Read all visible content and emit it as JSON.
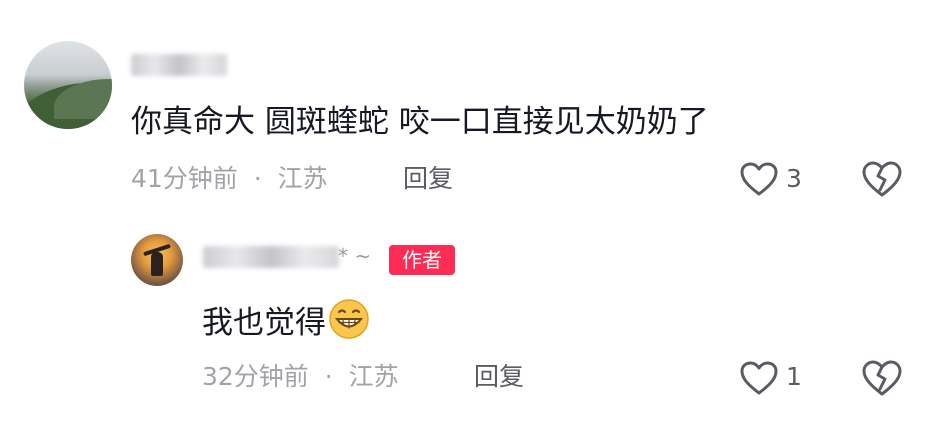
{
  "comments": [
    {
      "text": "你真命大  圆斑蝰蛇 咬一口直接见太奶奶了",
      "time": "41分钟前",
      "separator": "·",
      "location": "江苏",
      "reply_label": "回复",
      "likes": "3",
      "avatar_icon": "mountain-landscape-avatar",
      "username_redacted": true
    },
    {
      "text": "我也觉得",
      "emoji": "grinning-face",
      "badge": "作者",
      "username_suffix": "* ~",
      "time": "32分钟前",
      "separator": "·",
      "location": "江苏",
      "reply_label": "回复",
      "likes": "1",
      "avatar_icon": "sunset-figure-avatar",
      "username_redacted": true
    }
  ],
  "colors": {
    "badge": "#fe2c55",
    "meta": "#a2a3a8",
    "text": "#161823",
    "icon": "#5a5c63"
  }
}
